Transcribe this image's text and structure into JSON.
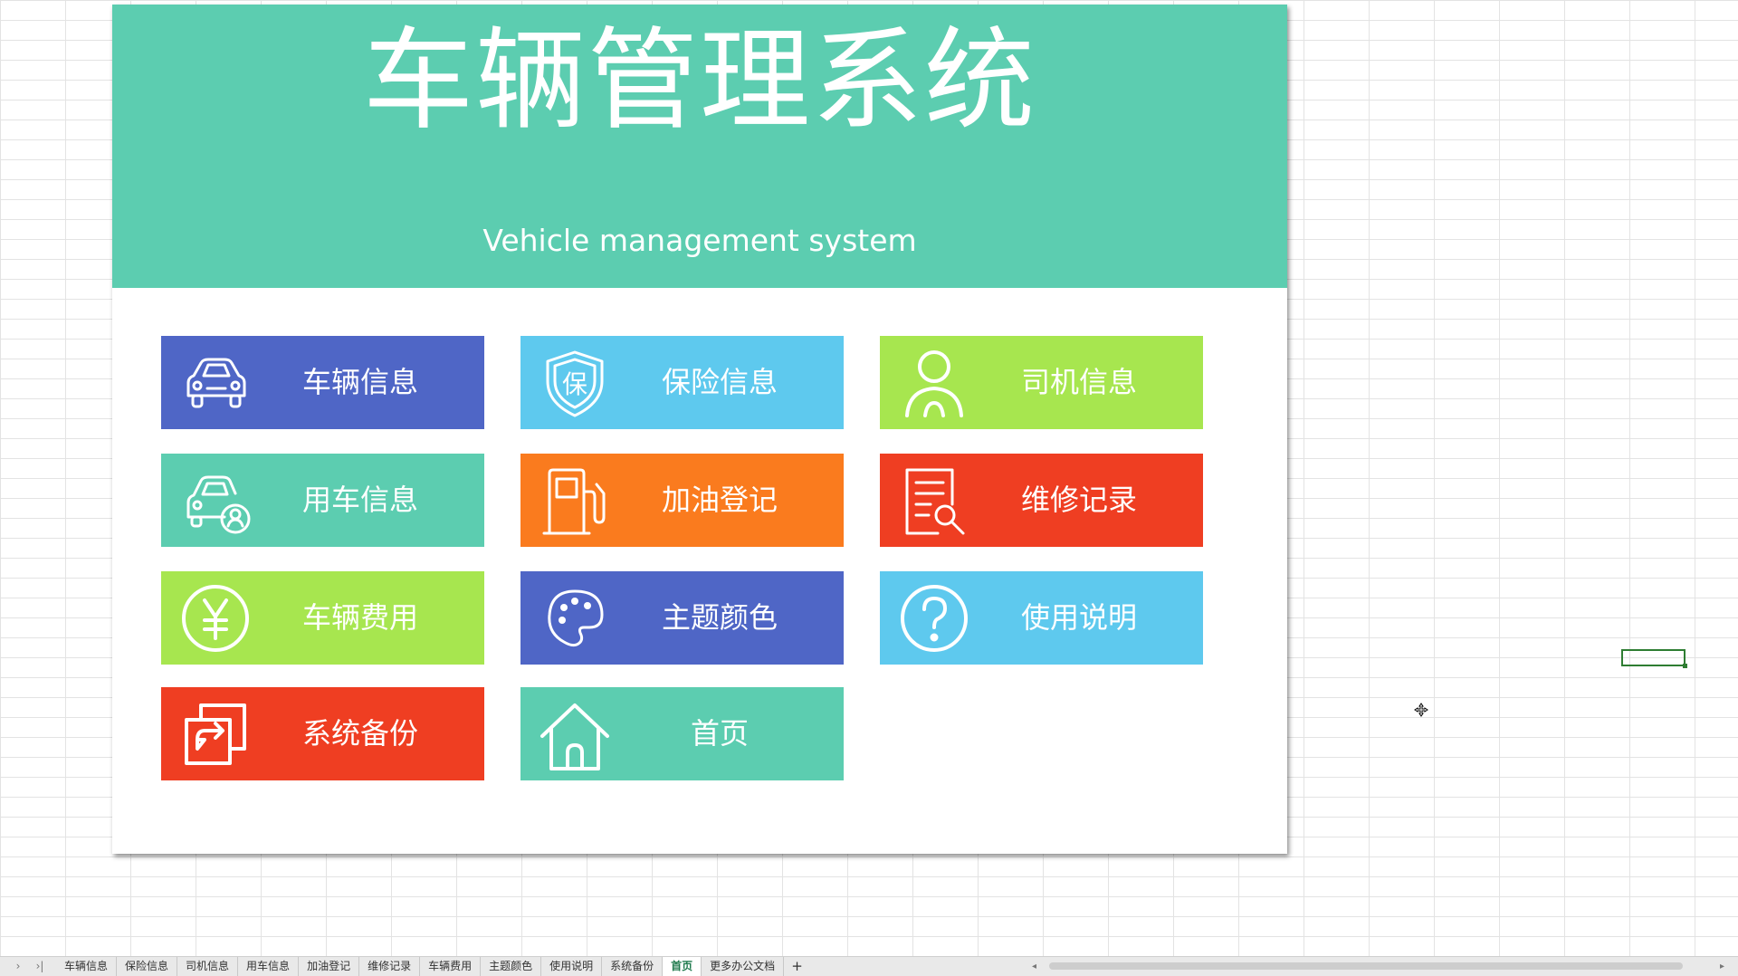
{
  "banner": {
    "title": "车辆管理系统",
    "subtitle": "Vehicle management system",
    "color": "#5ccdb0"
  },
  "tiles": [
    {
      "label": "车辆信息",
      "icon": "car-icon",
      "color": "#4f66c6"
    },
    {
      "label": "保险信息",
      "icon": "insurance-shield-icon",
      "color": "#5ec9ee"
    },
    {
      "label": "司机信息",
      "icon": "driver-person-icon",
      "color": "#a7e64f"
    },
    {
      "label": "用车信息",
      "icon": "car-user-icon",
      "color": "#5ccdb0"
    },
    {
      "label": "加油登记",
      "icon": "fuel-pump-icon",
      "color": "#fa7b1e"
    },
    {
      "label": "维修记录",
      "icon": "repair-document-icon",
      "color": "#ef3e22"
    },
    {
      "label": "车辆费用",
      "icon": "yen-coin-icon",
      "color": "#a7e64f"
    },
    {
      "label": "主题颜色",
      "icon": "palette-icon",
      "color": "#4f66c6"
    },
    {
      "label": "使用说明",
      "icon": "help-question-icon",
      "color": "#5ec9ee"
    },
    {
      "label": "系统备份",
      "icon": "backup-icon",
      "color": "#ef3e22"
    },
    {
      "label": "首页",
      "icon": "home-icon",
      "color": "#5ccdb0"
    }
  ],
  "tabbar": {
    "nav_prev": "›",
    "nav_last": "›|",
    "tabs": [
      "车辆信息",
      "保险信息",
      "司机信息",
      "用车信息",
      "加油登记",
      "维修记录",
      "车辆费用",
      "主题颜色",
      "使用说明",
      "系统备份",
      "首页",
      "更多办公文档"
    ],
    "active_tab": "首页",
    "add_label": "+",
    "scroll_left": "◂",
    "scroll_right": "▸"
  }
}
